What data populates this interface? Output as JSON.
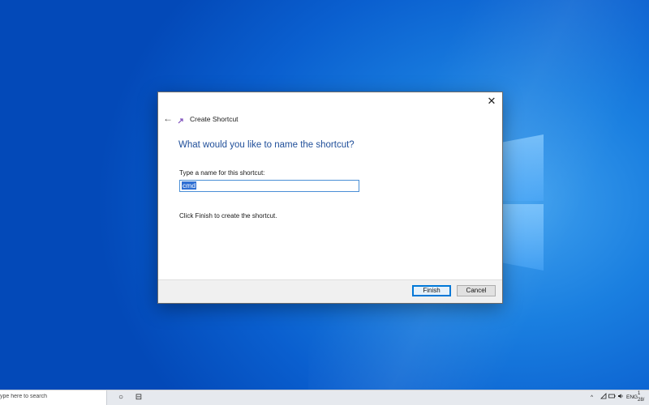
{
  "dialog": {
    "title": "Create Shortcut",
    "heading": "What would you like to name the shortcut?",
    "field_label": "Type a name for this shortcut:",
    "input_value": "cmd",
    "info_text": "Click Finish to create the shortcut.",
    "finish_label": "Finish",
    "cancel_label": "Cancel",
    "close_glyph": "✕",
    "back_glyph": "←",
    "icon": "shortcut-arrow-icon"
  },
  "taskbar": {
    "search_placeholder": "ype here to search",
    "cortana_glyph": "○",
    "task_view_glyph": "⊟",
    "tray": {
      "chevron": "^",
      "language": "ENG",
      "time_partial": "1",
      "date_partial": "28/"
    }
  },
  "colors": {
    "heading": "#1f4e99",
    "selection": "#2f6fd3",
    "accent": "#0078d7"
  }
}
